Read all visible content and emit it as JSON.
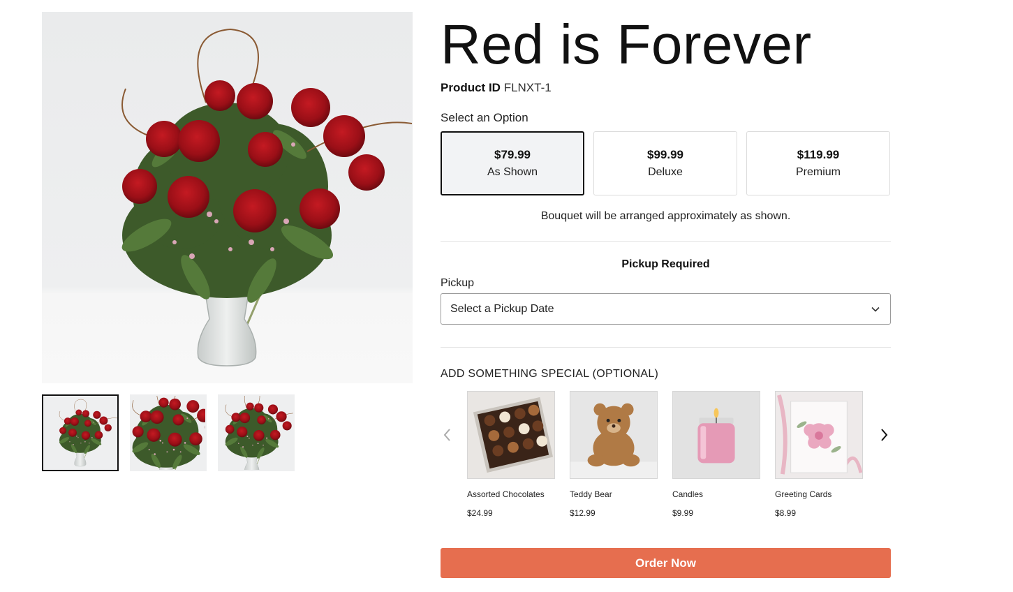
{
  "product": {
    "title": "Red is Forever",
    "id_label": "Product ID",
    "id_value": "FLNXT-1"
  },
  "options": {
    "heading": "Select an Option",
    "items": [
      {
        "price": "$79.99",
        "name": "As Shown",
        "selected": true
      },
      {
        "price": "$99.99",
        "name": "Deluxe",
        "selected": false
      },
      {
        "price": "$119.99",
        "name": "Premium",
        "selected": false
      }
    ],
    "note": "Bouquet will be arranged approximately as shown."
  },
  "pickup": {
    "required_text": "Pickup Required",
    "label": "Pickup",
    "select_value": "Select a Pickup Date"
  },
  "addons": {
    "heading": "ADD SOMETHING SPECIAL (OPTIONAL)",
    "items": [
      {
        "name": "Assorted Chocolates",
        "price": "$24.99"
      },
      {
        "name": "Teddy Bear",
        "price": "$12.99"
      },
      {
        "name": "Candles",
        "price": "$9.99"
      },
      {
        "name": "Greeting Cards",
        "price": "$8.99"
      }
    ]
  },
  "order_button": "Order Now",
  "colors": {
    "accent": "#e66e4f",
    "rose": "#a3121b",
    "selected_border": "#111111"
  }
}
